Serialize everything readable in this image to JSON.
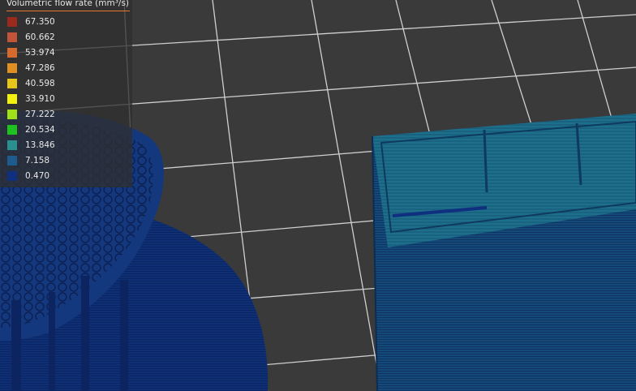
{
  "legend": {
    "title": "Volumetric flow rate (mm³/s)",
    "entries": [
      {
        "value": "67.350",
        "color": "#9b2a1c"
      },
      {
        "value": "60.662",
        "color": "#c2543a"
      },
      {
        "value": "53.974",
        "color": "#d66a2e"
      },
      {
        "value": "47.286",
        "color": "#e08f22"
      },
      {
        "value": "40.598",
        "color": "#e8c51b"
      },
      {
        "value": "33.910",
        "color": "#f2f20e"
      },
      {
        "value": "27.222",
        "color": "#9fe01b"
      },
      {
        "value": "20.534",
        "color": "#1ec21e"
      },
      {
        "value": "13.846",
        "color": "#2a8f8f"
      },
      {
        "value": "7.158",
        "color": "#1d5c8c"
      },
      {
        "value": "0.470",
        "color": "#0f2f7f"
      }
    ]
  },
  "scene": {
    "background_color": "#3a3a3a",
    "grid_color": "#cfcfcf",
    "objects": [
      "round-part",
      "box-part"
    ]
  }
}
